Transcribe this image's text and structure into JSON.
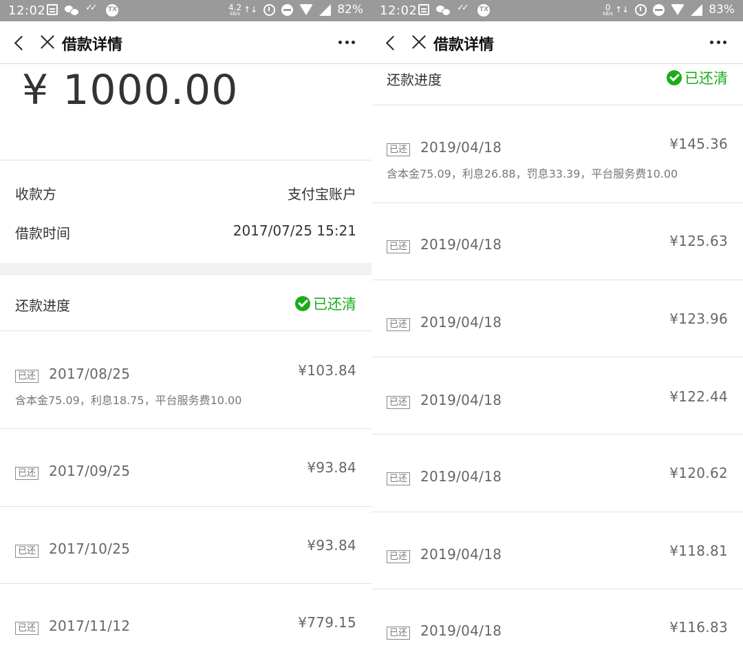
{
  "left": {
    "status": {
      "time": "12:02",
      "netspeed": "4.2",
      "netunit": "kB/s",
      "arrows": "↑↓",
      "battery": "82%"
    },
    "nav": {
      "title": "借款详情"
    },
    "amount": "¥ 1000.00",
    "info": [
      {
        "label": "收款方",
        "value": "支付宝账户"
      },
      {
        "label": "借款时间",
        "value": "2017/07/25 15:21"
      }
    ],
    "progress": {
      "label": "还款进度",
      "status": "已还清"
    },
    "payments": [
      {
        "tag": "已还",
        "date": "2017/08/25",
        "amount": "¥103.84",
        "detail": "含本金75.09，利息18.75，平台服务费10.00"
      },
      {
        "tag": "已还",
        "date": "2017/09/25",
        "amount": "¥93.84",
        "detail": ""
      },
      {
        "tag": "已还",
        "date": "2017/10/25",
        "amount": "¥93.84",
        "detail": ""
      },
      {
        "tag": "已还",
        "date": "2017/11/12",
        "amount": "¥779.15",
        "detail": ""
      }
    ]
  },
  "right": {
    "status": {
      "time": "12:02",
      "netspeed": "0",
      "netunit": "kB/s",
      "arrows": "↑↓",
      "battery": "83%"
    },
    "nav": {
      "title": "借款详情"
    },
    "progress": {
      "label": "还款进度",
      "status": "已还清"
    },
    "payments": [
      {
        "tag": "已还",
        "date": "2019/04/18",
        "amount": "¥145.36",
        "detail": "含本金75.09，利息26.88，罚息33.39，平台服务费10.00"
      },
      {
        "tag": "已还",
        "date": "2019/04/18",
        "amount": "¥125.63",
        "detail": ""
      },
      {
        "tag": "已还",
        "date": "2019/04/18",
        "amount": "¥123.96",
        "detail": ""
      },
      {
        "tag": "已还",
        "date": "2019/04/18",
        "amount": "¥122.44",
        "detail": ""
      },
      {
        "tag": "已还",
        "date": "2019/04/18",
        "amount": "¥120.62",
        "detail": ""
      },
      {
        "tag": "已还",
        "date": "2019/04/18",
        "amount": "¥118.81",
        "detail": ""
      },
      {
        "tag": "已还",
        "date": "2019/04/18",
        "amount": "¥116.83",
        "detail": ""
      }
    ]
  },
  "colors": {
    "accent_green": "#1aad19",
    "statusbar": "#9a9a9a"
  },
  "icons": [
    "back-icon",
    "close-icon",
    "more-icon",
    "check-circle-icon",
    "alarm-icon",
    "dnd-icon",
    "wifi-icon",
    "signal-icon"
  ]
}
